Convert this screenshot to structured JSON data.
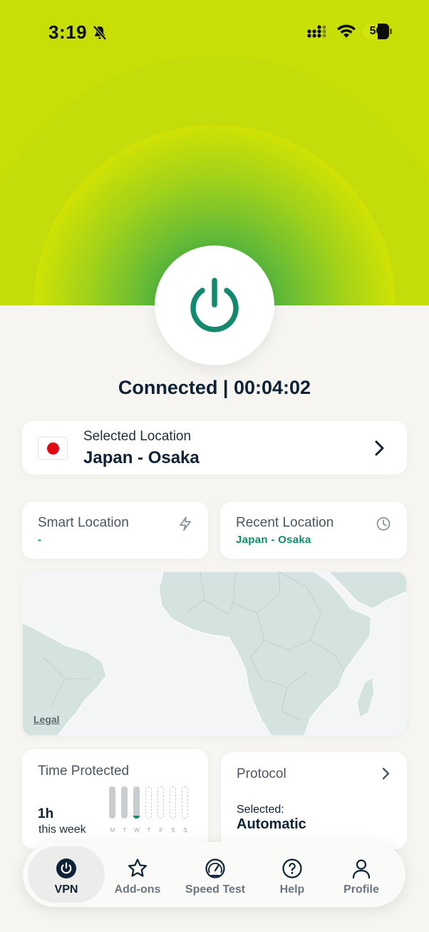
{
  "status_bar": {
    "time": "3:19",
    "battery_percent": "56",
    "battery_level": 0.56,
    "icons": [
      "bell-muted-icon",
      "cellular-signal-icon",
      "wifi-icon",
      "battery-icon"
    ]
  },
  "connection": {
    "status_text": "Connected | 00:04:02",
    "power_icon": "power-icon"
  },
  "selected_location": {
    "label": "Selected Location",
    "value": "Japan - Osaka",
    "flag": "japan-flag-icon"
  },
  "smart_location": {
    "title": "Smart Location",
    "value": "-",
    "icon": "lightning-bolt-icon"
  },
  "recent_location": {
    "title": "Recent Location",
    "value": "Japan - Osaka",
    "icon": "clock-icon"
  },
  "map": {
    "legal_link": "Legal"
  },
  "time_protected": {
    "title": "Time Protected",
    "value": "1h",
    "subtitle": "this week",
    "days": [
      "M",
      "T",
      "W",
      "T",
      "F",
      "S",
      "S"
    ],
    "day_levels": [
      1,
      1,
      0.1,
      0,
      0,
      0,
      0
    ]
  },
  "protocol": {
    "title": "Protocol",
    "selected_label": "Selected:",
    "selected_value": "Automatic"
  },
  "nav": {
    "items": [
      {
        "label": "VPN",
        "icon": "power-icon",
        "active": true
      },
      {
        "label": "Add-ons",
        "icon": "star-icon",
        "active": false
      },
      {
        "label": "Speed Test",
        "icon": "speedometer-icon",
        "active": false
      },
      {
        "label": "Help",
        "icon": "help-icon",
        "active": false
      },
      {
        "label": "Profile",
        "icon": "person-icon",
        "active": false
      }
    ]
  },
  "colors": {
    "accent_green": "#138a6e",
    "hero_lime": "#c8e108",
    "hero_green": "#2fa14a",
    "background": "#f6f5f1",
    "text_dark": "#0d2236"
  }
}
